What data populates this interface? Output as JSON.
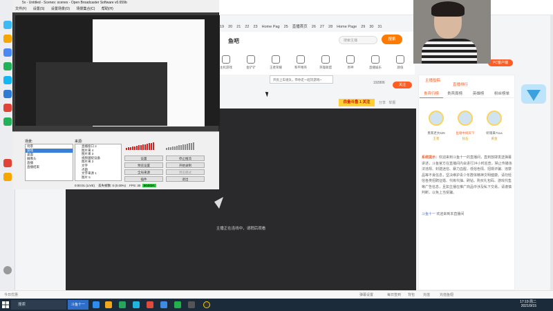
{
  "obs": {
    "title": "5x - Untitled - Scenes: scenes - Open Broadcaster Software v0.659b",
    "menu": [
      "文件(F)",
      "设置(S)",
      "设置场景(O)",
      "场景集合(C)",
      "帮助(H)"
    ],
    "scenes_label": "场景:",
    "sources_label": "来源:",
    "scenes": [
      "场景",
      "游戏",
      "桌面",
      "摄像头",
      "直播",
      "直播结束"
    ],
    "sources": [
      "直播窗口 2",
      "图片来 4",
      "图片来 3",
      "视频捕捉设备",
      "图片来 3",
      "文字",
      "点题",
      "文字来源 1",
      "图片 5"
    ],
    "buttons": {
      "settings": "设置",
      "stop_stream": "停止推流",
      "preview": "预览设置",
      "start_record": "开始录制",
      "global_sources": "全局来源",
      "studio": "预览模式",
      "plugins": "插件",
      "exit": "退出"
    },
    "status": {
      "time": "0:00:01 (LIVE)",
      "dropped": "丢失帧数: 0 (0.00%)",
      "fps": "FPS: 30",
      "kbps": "904kb/s"
    }
  },
  "browser": {
    "tabs": [
      "19",
      "20",
      "21",
      "22",
      "23",
      "Home Pag",
      "25",
      "直播首页",
      "26",
      "27",
      "28",
      "Home Page",
      "29",
      "30",
      "31"
    ],
    "logo": "鱼吧",
    "search_placeholder": "搜索主播",
    "search_button": "搜索",
    "nav": [
      "主机游戏",
      "金铲铲",
      "王者荣耀",
      "和平精英",
      "英雄联盟",
      "原神",
      "直播娱乐",
      "颜值"
    ],
    "tooltip": "开房上车组队，带你走一起玩游戏~",
    "room_count": "192806",
    "follow_label": "关注",
    "gift_badge": "白金斗鱼 1 关注",
    "share": "分享",
    "report": "举报",
    "video_caption": "主播正在连线中，请稍后观看"
  },
  "side": {
    "streamer_label": "主播投稿",
    "rank_label": "直播排行",
    "pc_badge": "PC客户端",
    "tabs": [
      "贵宾行榜",
      "贵宾周榜",
      "英雄榜",
      "粉丝榜单"
    ],
    "ranks": [
      {
        "name": "贵宾老大625",
        "tag": "王者"
      },
      {
        "name": "鱼塘中刚天下",
        "tag": "钻石"
      },
      {
        "name": "听雨来711a",
        "tag": "黄金"
      }
    ],
    "sys_title": "系统提示：",
    "sys_msg": "欢迎来到斗鱼十一的直播间，直到放肆发送弹幕讲述，斗鱼官方在直播间内会进行24小时巡查，禁止传播违法违规、封建迷信、暴力血腥、低俗色情、招嫖诈骗、违禁品等不良信息，坚决维护青少年群体精神文明健康。请勿轻信各类招聘征婚、代练代抽、刷钻、购买礼包码、游戏代售等广告信息，且如主播在推广商品中涉及私下交易，请谨慎判断，以免上当受骗。",
    "welcome_user": "斗鱼十一",
    "welcome_msg": "欢迎来到本直播间"
  },
  "bottom": {
    "left": "今日优惠",
    "items": [
      "弹幕设置",
      "每日签到",
      "背包",
      "充值",
      "充值鱼翅"
    ]
  },
  "taskbar": {
    "search": "搜索",
    "active": "斗鱼十一",
    "time": "17:19 周二",
    "date": "2021/9/15"
  },
  "colors": {
    "accent": "#ff5d23",
    "video_bg": "#2a2a2c",
    "taskbar": "#1c2b3a"
  }
}
